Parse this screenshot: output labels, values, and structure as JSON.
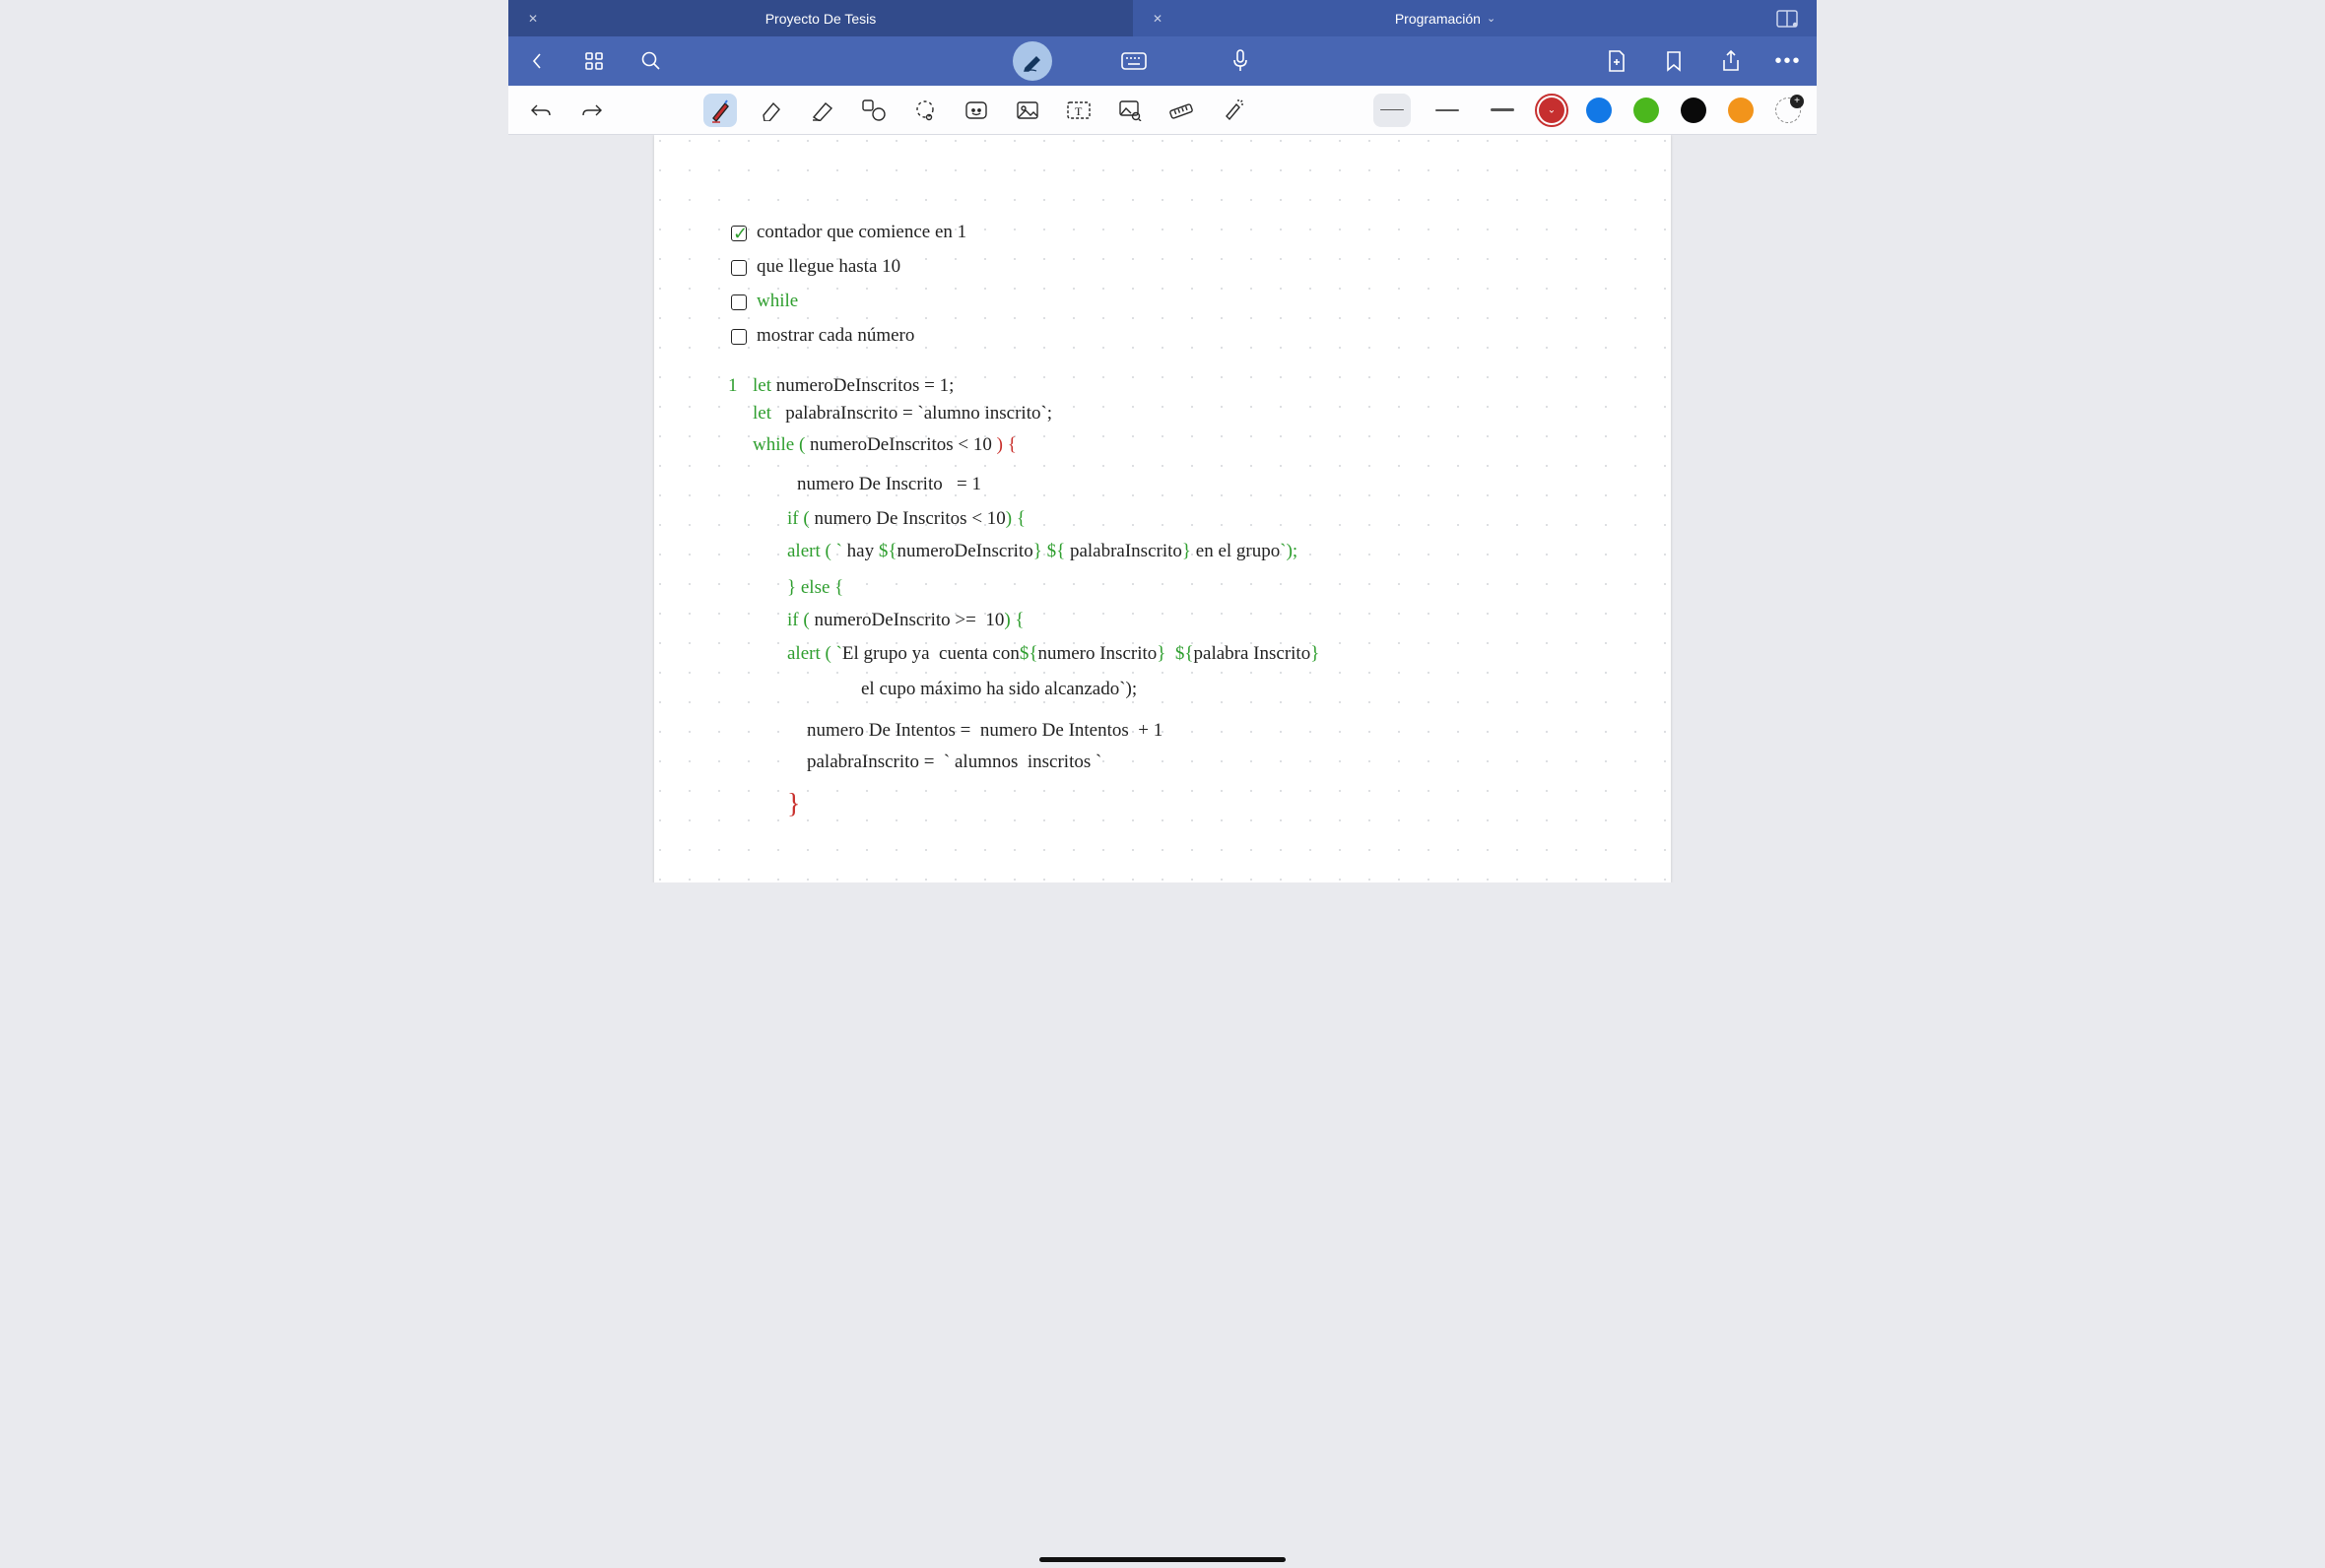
{
  "tabs": {
    "left": "Proyecto De Tesis",
    "right": "Programación"
  },
  "toolbar": {
    "colors": [
      "#c62f2f",
      "#1278e6",
      "#4bb71d",
      "#0a0a0a",
      "#f2941b"
    ],
    "selected_color_index": 0
  },
  "notes": {
    "check1": "contador que comience en 1",
    "check2": "que llegue hasta 10",
    "check3": "while",
    "check4": "mostrar cada número",
    "code_line_no": "1",
    "l1a": "let ",
    "l1b": "numeroDeInscritos = 1;",
    "l2a": "let   ",
    "l2b": "palabraInscrito = `alumno inscrito`;",
    "l3a": "while ( ",
    "l3b": "numeroDeInscritos < 10 ",
    "l3c": ") {",
    "l4": "numero De Inscrito   = 1",
    "l5a": "if ( ",
    "l5b": "numero De Inscritos < 10",
    "l5c": ") {",
    "l6a": "alert ( ` ",
    "l6b": "hay ",
    "l6c": "${",
    "l6d": "numeroDeInscrito",
    "l6e": "} ${ ",
    "l6f": "palabraInscrito",
    "l6g": "} ",
    "l6h": "en el grupo",
    "l6i": "`);",
    "l7a": "} else {",
    "l8a": "if ( ",
    "l8b": "numeroDeInscrito >=  10",
    "l8c": ") {",
    "l9a": "alert ( `",
    "l9b": "El grupo ya  cuenta con",
    "l9c": "${",
    "l9d": "numero Inscrito",
    "l9e": "}  ${",
    "l9f": "palabra Inscrito",
    "l9g": "}",
    "l10": "el cupo máximo ha sido alcanzado`);",
    "l11": "numero De Intentos =  numero De Intentos  + 1",
    "l12": "palabraInscrito =  ` alumnos  inscritos `",
    "l13": "}"
  }
}
